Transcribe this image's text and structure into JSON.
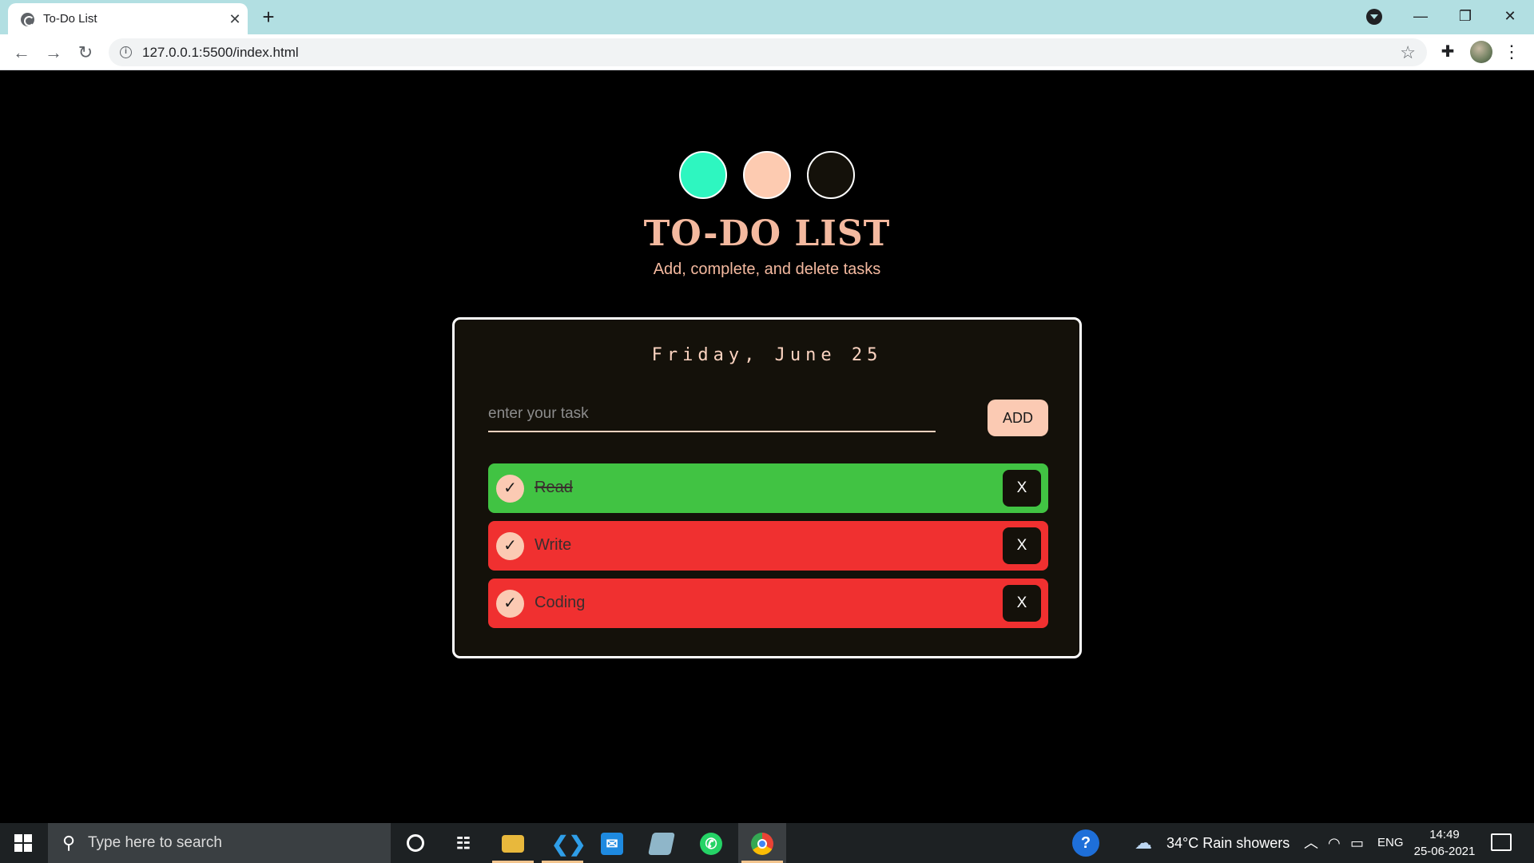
{
  "browser": {
    "tab_title": "To-Do List",
    "url": "127.0.0.1:5500/index.html"
  },
  "page": {
    "swatches": [
      {
        "name": "mint",
        "color": "#2ef6c0"
      },
      {
        "name": "peach",
        "color": "#fdcbb1"
      },
      {
        "name": "dark",
        "color": "#14110a"
      }
    ],
    "title": "TO-DO LIST",
    "subtitle": "Add, complete, and delete tasks",
    "date": "Friday, June 25",
    "input_placeholder": "enter your task",
    "add_label": "ADD",
    "tasks": [
      {
        "label": "Read",
        "done": true,
        "color": "#41c343"
      },
      {
        "label": "Write",
        "done": false,
        "color": "#f03030"
      },
      {
        "label": "Coding",
        "done": false,
        "color": "#f03030"
      }
    ],
    "delete_label": "X",
    "check_mark": "✓"
  },
  "taskbar": {
    "search_placeholder": "Type here to search",
    "weather": "34°C  Rain showers",
    "language": "ENG",
    "time": "14:49",
    "date": "25-06-2021"
  },
  "colors": {
    "accent": "#f4b99f",
    "card_bg": "#14110a",
    "tab_strip": "#b2dfe2"
  }
}
